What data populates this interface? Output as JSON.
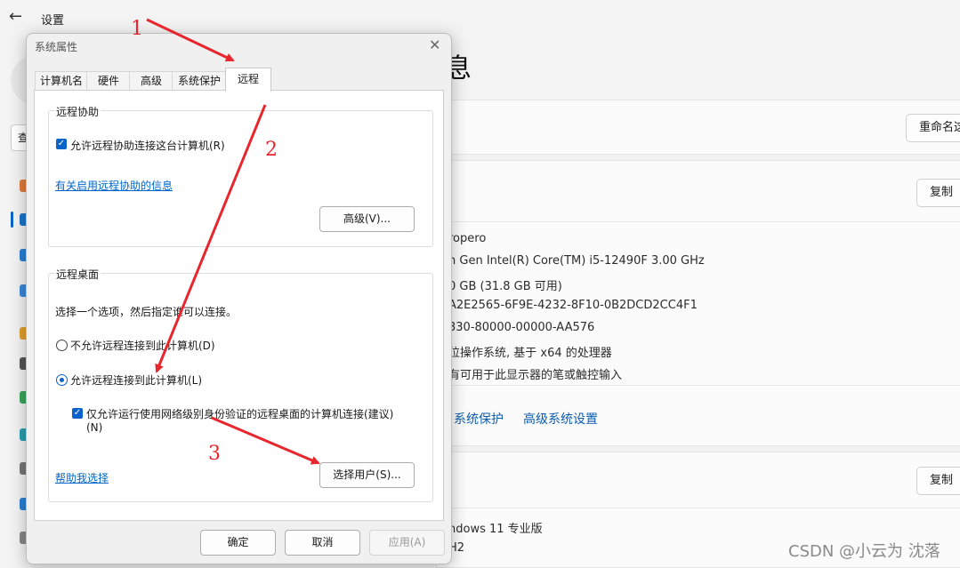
{
  "settings": {
    "title": "设置",
    "heading": "息",
    "rename_button": "重命名这",
    "copy_button_1": "复制",
    "copy_button_2": "复制",
    "specs": [
      "ropero",
      "h Gen Intel(R) Core(TM) i5-12490F   3.00 GHz",
      "0 GB (31.8 GB 可用)",
      "A2E2565-6F9E-4232-8F10-0B2DCD2CC4F1",
      "330-80000-00000-AA576",
      "位操作系统, 基于 x64 的处理器",
      "有可用于此显示器的笔或触控输入"
    ],
    "links": [
      "系统保护",
      "高级系统设置"
    ],
    "os_lines": [
      "ndows 11 专业版",
      "H2"
    ],
    "left_sliver": "查"
  },
  "dialog": {
    "title": "系统属性",
    "tabs": [
      "计算机名",
      "硬件",
      "高级",
      "系统保护",
      "远程"
    ],
    "active_tab": "远程",
    "remote_assistance": {
      "group_title": "远程协助",
      "checkbox_label": "允许远程协助连接这台计算机(R)",
      "checked": true,
      "info_link": "有关启用远程协助的信息",
      "advanced_button": "高级(V)..."
    },
    "remote_desktop": {
      "group_title": "远程桌面",
      "instruction": "选择一个选项，然后指定谁可以连接。",
      "option_deny": "不允许远程连接到此计算机(D)",
      "option_allow": "允许远程连接到此计算机(L)",
      "selected": "allow",
      "nla_label_line1": "仅允许运行使用网络级别身份验证的远程桌面的计算机连接(建议)",
      "nla_label_line2": "(N)",
      "nla_checked": true,
      "help_link": "帮助我选择",
      "select_users_button": "选择用户(S)..."
    },
    "ok_button": "确定",
    "cancel_button": "取消",
    "apply_button": "应用(A)"
  },
  "annotations": {
    "n1": "1",
    "n2": "2",
    "n3": "3"
  },
  "watermark": "CSDN @小云为 沈落",
  "colors": {
    "accent": "#0a63c9",
    "annotation_red": "#e8262e",
    "link": "#0066cc"
  }
}
